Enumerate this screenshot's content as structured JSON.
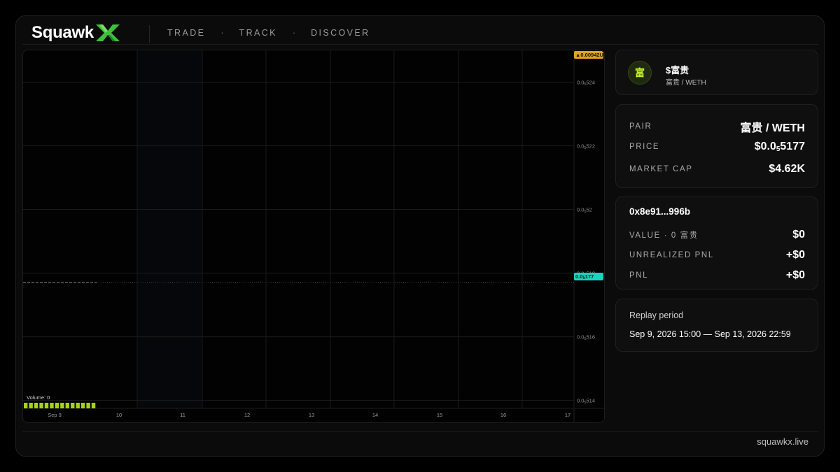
{
  "brand": {
    "logo_text": "Squawk",
    "logo_mark": "X"
  },
  "nav": {
    "items": [
      "TRADE",
      "TRACK",
      "DISCOVER"
    ],
    "separator": "·"
  },
  "chart": {
    "volume_label": "Volume: 0",
    "top_tag": "▲0.00942U",
    "current_tag_prefix": "0.0",
    "current_tag_sub": "5",
    "current_tag_suffix": "177"
  },
  "chart_data": {
    "type": "line",
    "y_ticks": [
      {
        "prefix": "0.0",
        "sub": "5",
        "rest": "524",
        "value": 5.24e-06
      },
      {
        "prefix": "0.0",
        "sub": "5",
        "rest": "522",
        "value": 5.22e-06
      },
      {
        "prefix": "0.0",
        "sub": "5",
        "rest": "52",
        "value": 5.2e-06
      },
      {
        "prefix": "0.0",
        "sub": "5",
        "rest": "518",
        "value": 5.18e-06
      },
      {
        "prefix": "0.0",
        "sub": "5",
        "rest": "516",
        "value": 5.16e-06
      },
      {
        "prefix": "0.0",
        "sub": "5",
        "rest": "514",
        "value": 5.14e-06
      }
    ],
    "x_ticks": [
      "Sep 9",
      "10",
      "11",
      "12",
      "13",
      "14",
      "15",
      "16",
      "17"
    ],
    "ylim": [
      5.1375e-06,
      5.25e-06
    ],
    "current_price": 5.177e-06,
    "volume_bar_count": 14,
    "volume_color": "#a6d21a",
    "grid": true
  },
  "token": {
    "avatar_char": "富",
    "name": "$富贵",
    "pair": "富贵 / WETH"
  },
  "info": {
    "pair_label": "PAIR",
    "pair_value": "富贵 / WETH",
    "price_label": "PRICE",
    "price_prefix": "$0.0",
    "price_sub": "5",
    "price_suffix": "5177",
    "mcap_label": "MARKET CAP",
    "mcap_value": "$4.62K"
  },
  "position": {
    "address": "0x8e91...996b",
    "value_label": "VALUE · 0 富贵",
    "value": "$0",
    "upnl_label": "UNREALIZED PNL",
    "upnl_value": "+$0",
    "pnl_label": "PNL",
    "pnl_value": "+$0"
  },
  "replay": {
    "title": "Replay period",
    "range": "Sep 9, 2026 15:00 — Sep 13, 2026 22:59"
  },
  "footer": {
    "link": "squawkx.live"
  },
  "colors": {
    "accent_green": "#a6d21a",
    "price_tag": "#1fd1bf",
    "high_tag": "#e0a41f",
    "logo_x": "#3fbf3a"
  }
}
